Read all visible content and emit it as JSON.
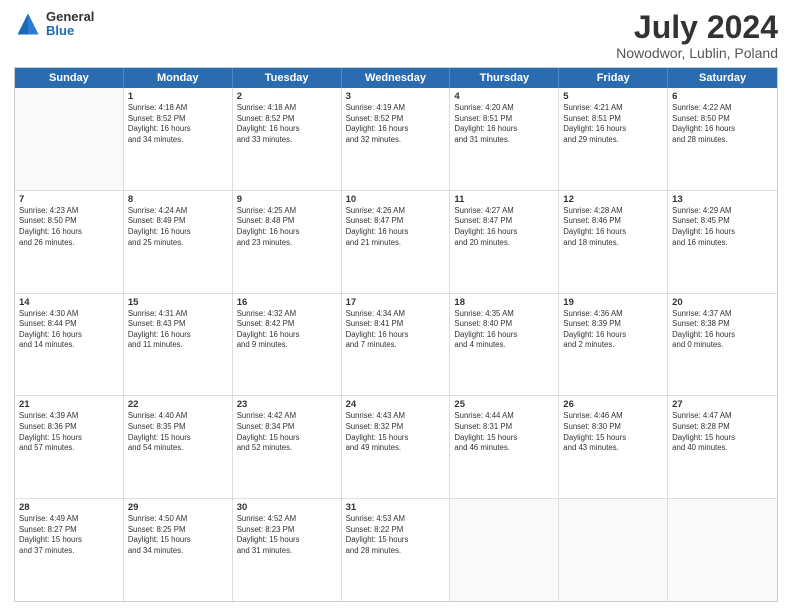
{
  "header": {
    "logo_general": "General",
    "logo_blue": "Blue",
    "title": "July 2024",
    "location": "Nowodwor, Lublin, Poland"
  },
  "days": [
    "Sunday",
    "Monday",
    "Tuesday",
    "Wednesday",
    "Thursday",
    "Friday",
    "Saturday"
  ],
  "weeks": [
    [
      {
        "day": "",
        "info": ""
      },
      {
        "day": "1",
        "info": "Sunrise: 4:18 AM\nSunset: 8:52 PM\nDaylight: 16 hours\nand 34 minutes."
      },
      {
        "day": "2",
        "info": "Sunrise: 4:18 AM\nSunset: 8:52 PM\nDaylight: 16 hours\nand 33 minutes."
      },
      {
        "day": "3",
        "info": "Sunrise: 4:19 AM\nSunset: 8:52 PM\nDaylight: 16 hours\nand 32 minutes."
      },
      {
        "day": "4",
        "info": "Sunrise: 4:20 AM\nSunset: 8:51 PM\nDaylight: 16 hours\nand 31 minutes."
      },
      {
        "day": "5",
        "info": "Sunrise: 4:21 AM\nSunset: 8:51 PM\nDaylight: 16 hours\nand 29 minutes."
      },
      {
        "day": "6",
        "info": "Sunrise: 4:22 AM\nSunset: 8:50 PM\nDaylight: 16 hours\nand 28 minutes."
      }
    ],
    [
      {
        "day": "7",
        "info": "Sunrise: 4:23 AM\nSunset: 8:50 PM\nDaylight: 16 hours\nand 26 minutes."
      },
      {
        "day": "8",
        "info": "Sunrise: 4:24 AM\nSunset: 8:49 PM\nDaylight: 16 hours\nand 25 minutes."
      },
      {
        "day": "9",
        "info": "Sunrise: 4:25 AM\nSunset: 8:48 PM\nDaylight: 16 hours\nand 23 minutes."
      },
      {
        "day": "10",
        "info": "Sunrise: 4:26 AM\nSunset: 8:47 PM\nDaylight: 16 hours\nand 21 minutes."
      },
      {
        "day": "11",
        "info": "Sunrise: 4:27 AM\nSunset: 8:47 PM\nDaylight: 16 hours\nand 20 minutes."
      },
      {
        "day": "12",
        "info": "Sunrise: 4:28 AM\nSunset: 8:46 PM\nDaylight: 16 hours\nand 18 minutes."
      },
      {
        "day": "13",
        "info": "Sunrise: 4:29 AM\nSunset: 8:45 PM\nDaylight: 16 hours\nand 16 minutes."
      }
    ],
    [
      {
        "day": "14",
        "info": "Sunrise: 4:30 AM\nSunset: 8:44 PM\nDaylight: 16 hours\nand 14 minutes."
      },
      {
        "day": "15",
        "info": "Sunrise: 4:31 AM\nSunset: 8:43 PM\nDaylight: 16 hours\nand 11 minutes."
      },
      {
        "day": "16",
        "info": "Sunrise: 4:32 AM\nSunset: 8:42 PM\nDaylight: 16 hours\nand 9 minutes."
      },
      {
        "day": "17",
        "info": "Sunrise: 4:34 AM\nSunset: 8:41 PM\nDaylight: 16 hours\nand 7 minutes."
      },
      {
        "day": "18",
        "info": "Sunrise: 4:35 AM\nSunset: 8:40 PM\nDaylight: 16 hours\nand 4 minutes."
      },
      {
        "day": "19",
        "info": "Sunrise: 4:36 AM\nSunset: 8:39 PM\nDaylight: 16 hours\nand 2 minutes."
      },
      {
        "day": "20",
        "info": "Sunrise: 4:37 AM\nSunset: 8:38 PM\nDaylight: 16 hours\nand 0 minutes."
      }
    ],
    [
      {
        "day": "21",
        "info": "Sunrise: 4:39 AM\nSunset: 8:36 PM\nDaylight: 15 hours\nand 57 minutes."
      },
      {
        "day": "22",
        "info": "Sunrise: 4:40 AM\nSunset: 8:35 PM\nDaylight: 15 hours\nand 54 minutes."
      },
      {
        "day": "23",
        "info": "Sunrise: 4:42 AM\nSunset: 8:34 PM\nDaylight: 15 hours\nand 52 minutes."
      },
      {
        "day": "24",
        "info": "Sunrise: 4:43 AM\nSunset: 8:32 PM\nDaylight: 15 hours\nand 49 minutes."
      },
      {
        "day": "25",
        "info": "Sunrise: 4:44 AM\nSunset: 8:31 PM\nDaylight: 15 hours\nand 46 minutes."
      },
      {
        "day": "26",
        "info": "Sunrise: 4:46 AM\nSunset: 8:30 PM\nDaylight: 15 hours\nand 43 minutes."
      },
      {
        "day": "27",
        "info": "Sunrise: 4:47 AM\nSunset: 8:28 PM\nDaylight: 15 hours\nand 40 minutes."
      }
    ],
    [
      {
        "day": "28",
        "info": "Sunrise: 4:49 AM\nSunset: 8:27 PM\nDaylight: 15 hours\nand 37 minutes."
      },
      {
        "day": "29",
        "info": "Sunrise: 4:50 AM\nSunset: 8:25 PM\nDaylight: 15 hours\nand 34 minutes."
      },
      {
        "day": "30",
        "info": "Sunrise: 4:52 AM\nSunset: 8:23 PM\nDaylight: 15 hours\nand 31 minutes."
      },
      {
        "day": "31",
        "info": "Sunrise: 4:53 AM\nSunset: 8:22 PM\nDaylight: 15 hours\nand 28 minutes."
      },
      {
        "day": "",
        "info": ""
      },
      {
        "day": "",
        "info": ""
      },
      {
        "day": "",
        "info": ""
      }
    ]
  ]
}
